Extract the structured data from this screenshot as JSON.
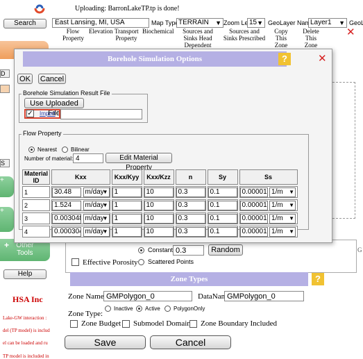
{
  "toolbar": {
    "search_label": "Search",
    "upload_status": "Uploading: BarronLakeTP.tp is done!",
    "location_value": "East Lansing, MI, USA",
    "map_type_label": "Map Type",
    "map_type_value": "TERRAIN",
    "zoom_label": "Zoom Level",
    "zoom_value": "15",
    "geolayer_label": "GeoLayer Name",
    "geolayer_value": "Layer1",
    "geolayer_cut": "GeoLa",
    "tabs": [
      "Flow Property",
      "Elevation",
      "Transport Property",
      "Biochemical",
      "Sources and Sinks Head Dependent",
      "Sources and Sinks Prescribed",
      "Copy This Zone",
      "Delete This Zone"
    ]
  },
  "sidebar": {
    "other_tools": "Other Tools",
    "help": "Help",
    "company": "HSA Inc",
    "notes": [
      "Lake-GW interaction :",
      "del (TP model) is includ",
      "el can be loaded and ru",
      "TP model is included in"
    ]
  },
  "dialog": {
    "title": "Borehole Simulation Options",
    "help_glyph": "?",
    "close_glyph": "✕",
    "ok": "OK",
    "cancel": "Cancel",
    "result_file_legend": "Borehole Simulation Result File",
    "use_uploaded_file": "Use Uploaded File",
    "import_link": "Import",
    "flow_property_legend": "Flow Property",
    "nearest": "Nearest",
    "bilinear": "Bilinear",
    "num_material_label": "Number of material:",
    "num_material_value": "4",
    "edit_material": "Edit Material Property",
    "table_headers": [
      "Material ID",
      "Kxx",
      "Kxx/Kyy",
      "Kxx/Kzz",
      "n",
      "Sy",
      "Ss"
    ],
    "rows": [
      {
        "id": "1",
        "kxx": "30.48",
        "kxx_unit": "m/day",
        "kxx_kyy": "1",
        "kxx_kzz": "10",
        "n": "0.3",
        "sy": "0.1",
        "ss": "0.00001",
        "ss_unit": "1/m"
      },
      {
        "id": "2",
        "kxx": "1.524",
        "kxx_unit": "m/day",
        "kxx_kyy": "1",
        "kxx_kzz": "10",
        "n": "0.3",
        "sy": "0.1",
        "ss": "0.00001",
        "ss_unit": "1/m"
      },
      {
        "id": "3",
        "kxx": "0.0030480",
        "kxx_unit": "m/day",
        "kxx_kyy": "1",
        "kxx_kzz": "10",
        "n": "0.3",
        "sy": "0.1",
        "ss": "0.00001",
        "ss_unit": "1/m"
      },
      {
        "id": "4",
        "kxx": "0.0003048",
        "kxx_unit": "m/day",
        "kxx_kyy": "1",
        "kxx_kzz": "10",
        "n": "0.3",
        "sy": "0.1",
        "ss": "0.00001",
        "ss_unit": "1/m"
      }
    ]
  },
  "porosity": {
    "constant_label": "Constant:",
    "constant_value": "0.3",
    "random": "Random",
    "scattered": "Scattered Points",
    "effective": "Effective Porosity"
  },
  "zone": {
    "title": "Zone Types",
    "help_glyph": "?",
    "zone_name_label": "Zone Name:",
    "zone_name_value": "GMPolygon_0",
    "data_name_label": "DataName:",
    "data_name_value": "GMPolygon_0",
    "zone_type_label": "Zone Type:",
    "inactive": "Inactive",
    "active": "Active",
    "polygon_only": "PolygonOnly",
    "zone_budget": "Zone Budget",
    "submodel": "Submodel Domain",
    "zone_boundary": "Zone Boundary Included",
    "save": "Save",
    "cancel": "Cancel",
    "g_cut": "G"
  }
}
